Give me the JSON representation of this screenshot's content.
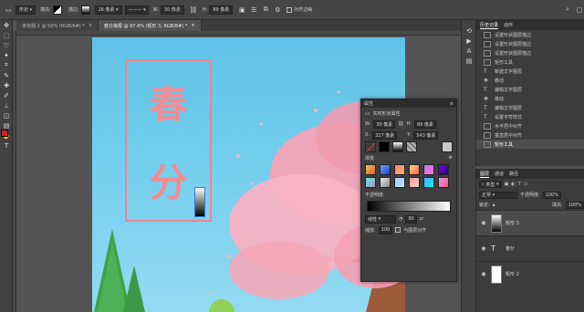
{
  "options_bar": {
    "shape_mode": "形状",
    "fill_label": "填充:",
    "stroke_label": "描边:",
    "stroke_size": "16 像素",
    "w_label": "W:",
    "w_value": "30 像素",
    "link_icon": "link-icon",
    "h_label": "H:",
    "h_value": "89 像素",
    "align_edges": "对齐边缘"
  },
  "tabs": [
    {
      "label": "未标题-1 @ 50% (RGB/8#) *",
      "close": "×"
    },
    {
      "label": "春分海报 @ 97.4% (矩形 3, RGB/8#) *",
      "close": "×"
    }
  ],
  "canvas": {
    "title_chars": [
      "春",
      "分"
    ],
    "sky_top": "#5ec2e6",
    "accent_pink": "#f08d93"
  },
  "history_panel": {
    "tabs": [
      "历史记录",
      "动作"
    ],
    "items": [
      "设置形状图层描边",
      "设置形状图层描边",
      "设置形状图层描边",
      "矩形工具",
      "新建文字图层",
      "移动",
      "编辑文字图层",
      "移动",
      "编辑文字图层",
      "设置字符样式",
      "水平居中对齐",
      "垂直居中对齐",
      "矩形工具"
    ],
    "selected_index": 12
  },
  "layers_panel": {
    "tabs": [
      "图层",
      "通道",
      "路径"
    ],
    "kind_label": "类型",
    "blend_mode": "正常",
    "opacity_label": "不透明度:",
    "opacity_value": "100%",
    "lock_label": "锁定:",
    "fill_label": "填充:",
    "fill_value": "100%",
    "layers": [
      {
        "name": "矩形 3",
        "type": "shape"
      },
      {
        "name": "春分",
        "type": "text"
      },
      {
        "name": "矩形 2",
        "type": "shape"
      }
    ],
    "selected_index": 0
  },
  "properties_panel": {
    "header": "属性",
    "subtitle": "实时形状属性",
    "w_label": "W:",
    "w_value": "30 像素",
    "h_label": "H:",
    "h_value": "89 像素",
    "x_label": "X:",
    "x_value": "327 像素",
    "y_label": "Y:",
    "y_value": "543 像素",
    "stroke_size": "16 像素",
    "gradient_label": "渐变",
    "opacity_label": "不透明度:",
    "style_value": "线性",
    "angle_value": "90",
    "scale_label": "缩放:",
    "scale_value": "100",
    "align_with_layer": "与图层对齐"
  }
}
